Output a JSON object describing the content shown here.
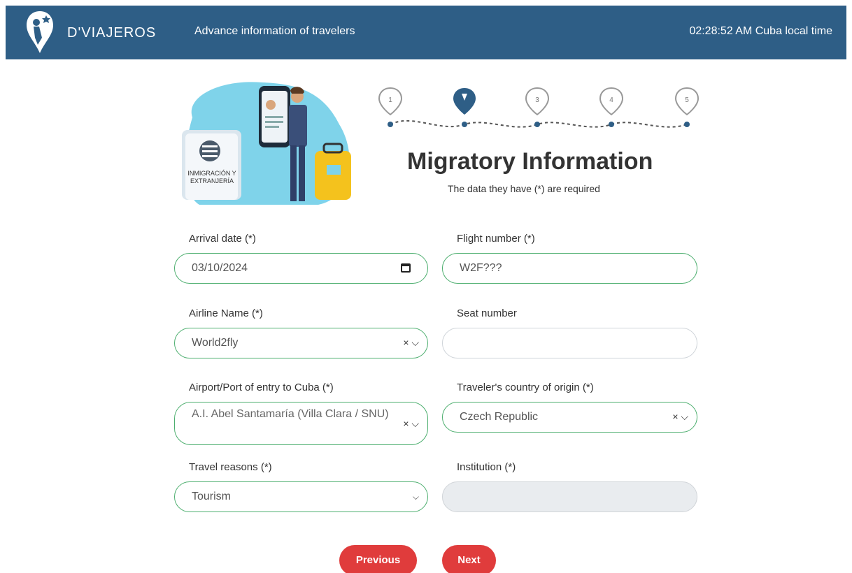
{
  "header": {
    "brand": "D'VIAJEROS",
    "subtitle": "Advance information of travelers",
    "clock": "02:28:52 AM Cuba local time",
    "bg_color": "#2e5e86"
  },
  "illustration": {
    "sign_text_line1": "INMIGRACIÓN Y",
    "sign_text_line2": "EXTRANJERÍA"
  },
  "steps": {
    "items": [
      "1",
      "2",
      "3",
      "4",
      "5"
    ],
    "active_index": 1,
    "active_icon": "traveler-icon"
  },
  "page": {
    "title": "Migratory Information",
    "required_note": "The data they have (*) are required"
  },
  "form": {
    "arrival_date": {
      "label": "Arrival date (*)",
      "value": "03/10/2024"
    },
    "flight_number": {
      "label": "Flight number (*)",
      "value": "W2F???"
    },
    "airline_name": {
      "label": "Airline Name (*)",
      "value": "World2fly"
    },
    "seat_number": {
      "label": "Seat number",
      "value": ""
    },
    "airport": {
      "label": "Airport/Port of entry to Cuba (*)",
      "value": "A.I. Abel Santamaría (Villa Clara / SNU)"
    },
    "country": {
      "label": "Traveler's country of origin (*)",
      "value": "Czech Republic"
    },
    "travel_reasons": {
      "label": "Travel reasons (*)",
      "value": "Tourism"
    },
    "institution": {
      "label": "Institution (*)",
      "value": ""
    }
  },
  "buttons": {
    "previous": "Previous",
    "next": "Next",
    "color": "#e03c3c"
  },
  "colors": {
    "field_border": "#4cae6e"
  }
}
